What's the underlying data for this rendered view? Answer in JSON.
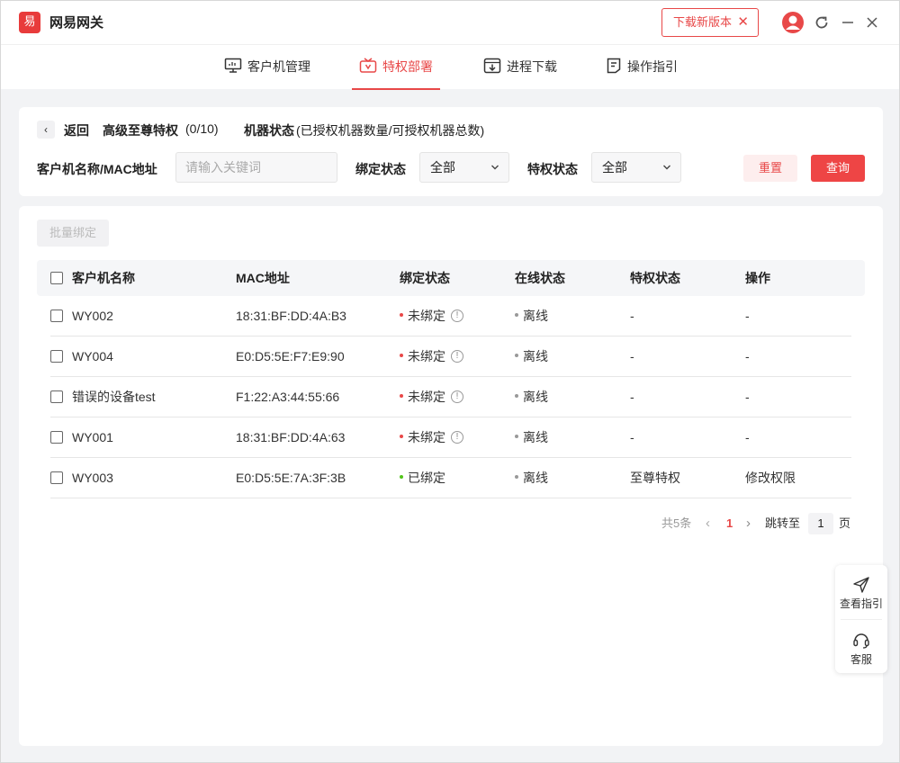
{
  "app": {
    "logo_char": "易",
    "title": "网易网关"
  },
  "titlebar": {
    "download_label": "下载新版本",
    "download_close": "✕"
  },
  "nav": {
    "tabs": [
      "客户机管理",
      "特权部署",
      "进程下载",
      "操作指引"
    ],
    "active": 1
  },
  "filter": {
    "back_icon": "‹",
    "back_label": "返回",
    "tier_label": "高级至尊特权",
    "tier_count": "(0/10)",
    "status_label": "机器状态",
    "status_desc": "(已授权机器数量/可授权机器总数)",
    "name_label": "客户机名称/MAC地址",
    "name_placeholder": "请输入关键词",
    "bind_label": "绑定状态",
    "bind_value": "全部",
    "priv_label": "特权状态",
    "priv_value": "全部",
    "reset_label": "重置",
    "query_label": "查询"
  },
  "table": {
    "batch_label": "批量绑定",
    "headers": [
      "客户机名称",
      "MAC地址",
      "绑定状态",
      "在线状态",
      "特权状态",
      "操作"
    ],
    "rows": [
      {
        "name": "WY002",
        "mac": "18:31:BF:DD:4A:B3",
        "bind": "未绑定",
        "online": "离线",
        "priv": "-",
        "action": "-"
      },
      {
        "name": "WY004",
        "mac": "E0:D5:5E:F7:E9:90",
        "bind": "未绑定",
        "online": "离线",
        "priv": "-",
        "action": "-"
      },
      {
        "name": "错误的设备test",
        "mac": "F1:22:A3:44:55:66",
        "bind": "未绑定",
        "online": "离线",
        "priv": "-",
        "action": "-"
      },
      {
        "name": "WY001",
        "mac": "18:31:BF:DD:4A:63",
        "bind": "未绑定",
        "online": "离线",
        "priv": "-",
        "action": "-"
      },
      {
        "name": "WY003",
        "mac": "E0:D5:5E:7A:3F:3B",
        "bind": "已绑定",
        "online": "离线",
        "priv": "至尊特权",
        "action": "修改权限"
      }
    ],
    "info_glyph": "!"
  },
  "pagination": {
    "total": "共5条",
    "prev": "‹",
    "current": "1",
    "next": "›",
    "jump_label": "跳转至",
    "jump_value": "1",
    "page_unit": "页"
  },
  "float_panel": {
    "guide_label": "查看指引",
    "service_label": "客服"
  },
  "colors": {
    "accent": "#e84848",
    "unbound_dot": "#e84848",
    "bound_dot": "#52c41a",
    "offline_dot": "#999999"
  }
}
